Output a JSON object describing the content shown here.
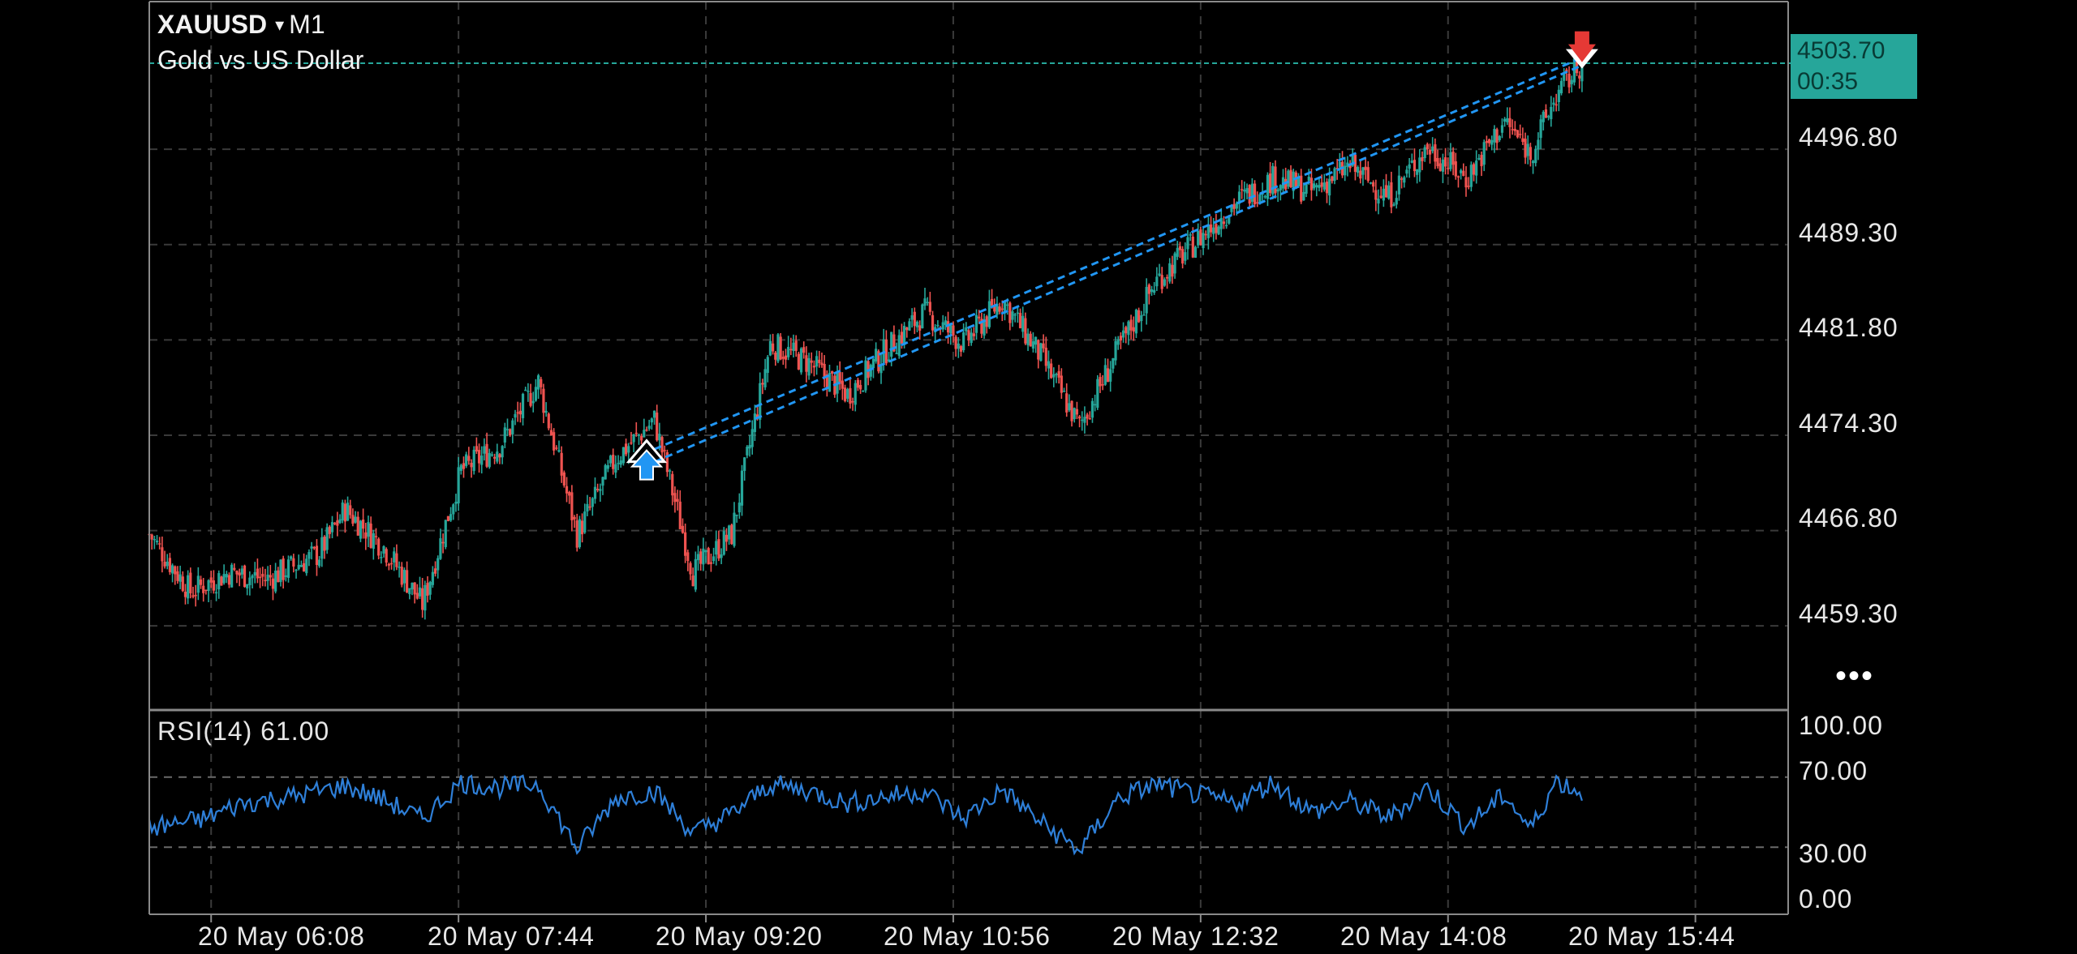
{
  "symbol": "XAUUSD",
  "timeframe": "M1",
  "description": "Gold vs US Dollar",
  "dropdown_glyph": "▾",
  "menu_glyph": "•••",
  "current_price": "4503.70",
  "candle_timer": "00:35",
  "price_axis": [
    "4496.80",
    "4489.30",
    "4481.80",
    "4474.30",
    "4466.80",
    "4459.30"
  ],
  "rsi": {
    "label": "RSI(14) 61.00",
    "levels": [
      "100.00",
      "70.00",
      "30.00",
      "0.00"
    ]
  },
  "time_axis": [
    "20 May 06:08",
    "20 May 07:44",
    "20 May 09:20",
    "20 May 10:56",
    "20 May 12:32",
    "20 May 14:08",
    "20 May 15:44"
  ],
  "colors": {
    "background": "#000000",
    "grid": "#3a3a3a",
    "bull": "#26a69a",
    "bear": "#ef5350",
    "trendline": "#2196f3",
    "rsi_line": "#2e7fd8",
    "price_tag": "#26a69a",
    "buy_arrow": "#2196f3",
    "sell_arrow": "#e53935"
  },
  "chart_data": {
    "type": "candlestick",
    "ylim": [
      4454.0,
      4505.0
    ],
    "xlim": [
      "20 May 05:44",
      "20 May 16:20"
    ],
    "price_path": [
      [
        "20 May 05:44",
        4466.5
      ],
      [
        "20 May 06:00",
        4462.0
      ],
      [
        "20 May 06:15",
        4463.5
      ],
      [
        "20 May 06:30",
        4463.0
      ],
      [
        "20 May 06:50",
        4465.0
      ],
      [
        "20 May 07:00",
        4468.5
      ],
      [
        "20 May 07:15",
        4465.5
      ],
      [
        "20 May 07:30",
        4461.0
      ],
      [
        "20 May 07:45",
        4471.5
      ],
      [
        "20 May 08:00",
        4473.5
      ],
      [
        "20 May 08:15",
        4478.5
      ],
      [
        "20 May 08:30",
        4466.5
      ],
      [
        "20 May 08:45",
        4472.5
      ],
      [
        "20 May 09:00",
        4475.5
      ],
      [
        "20 May 09:15",
        4463.5
      ],
      [
        "20 May 09:30",
        4466.5
      ],
      [
        "20 May 09:45",
        4481.5
      ],
      [
        "20 May 10:00",
        4480.0
      ],
      [
        "20 May 10:15",
        4477.5
      ],
      [
        "20 May 10:30",
        4481.0
      ],
      [
        "20 May 10:45",
        4484.0
      ],
      [
        "20 May 11:00",
        4481.5
      ],
      [
        "20 May 11:15",
        4485.0
      ],
      [
        "20 May 11:30",
        4480.5
      ],
      [
        "20 May 11:45",
        4475.0
      ],
      [
        "20 May 12:00",
        4481.0
      ],
      [
        "20 May 12:15",
        4486.5
      ],
      [
        "20 May 12:30",
        4489.5
      ],
      [
        "20 May 12:45",
        4492.5
      ],
      [
        "20 May 13:00",
        4494.5
      ],
      [
        "20 May 13:15",
        4493.5
      ],
      [
        "20 May 13:30",
        4495.5
      ],
      [
        "20 May 13:45",
        4493.0
      ],
      [
        "20 May 14:00",
        4497.0
      ],
      [
        "20 May 14:15",
        4494.5
      ],
      [
        "20 May 14:30",
        4499.0
      ],
      [
        "20 May 14:40",
        4496.5
      ],
      [
        "20 May 14:50",
        4501.0
      ],
      [
        "20 May 15:00",
        4503.7
      ]
    ],
    "trendlines": [
      {
        "from": [
          "20 May 09:00",
          4473.2
        ],
        "to": [
          "20 May 15:00",
          4504.0
        ]
      },
      {
        "from": [
          "20 May 09:00",
          4472.2
        ],
        "to": [
          "20 May 15:00",
          4503.4
        ]
      }
    ],
    "markers": [
      {
        "type": "buy",
        "time": "20 May 08:57",
        "price": 4472.6
      },
      {
        "type": "sell",
        "time": "20 May 15:00",
        "price": 4504.3
      }
    ],
    "rsi_path": [
      [
        "20 May 05:44",
        41
      ],
      [
        "20 May 06:05",
        46
      ],
      [
        "20 May 06:20",
        55
      ],
      [
        "20 May 06:40",
        59
      ],
      [
        "20 May 07:00",
        65
      ],
      [
        "20 May 07:15",
        57
      ],
      [
        "20 May 07:30",
        46
      ],
      [
        "20 May 07:45",
        67
      ],
      [
        "20 May 08:00",
        64
      ],
      [
        "20 May 08:15",
        66
      ],
      [
        "20 May 08:30",
        29
      ],
      [
        "20 May 08:45",
        58
      ],
      [
        "20 May 09:00",
        62
      ],
      [
        "20 May 09:15",
        38
      ],
      [
        "20 May 09:30",
        49
      ],
      [
        "20 May 09:45",
        66
      ],
      [
        "20 May 10:00",
        62
      ],
      [
        "20 May 10:15",
        55
      ],
      [
        "20 May 10:30",
        59
      ],
      [
        "20 May 10:45",
        62
      ],
      [
        "20 May 11:00",
        46
      ],
      [
        "20 May 11:15",
        63
      ],
      [
        "20 May 11:30",
        44
      ],
      [
        "20 May 11:45",
        28
      ],
      [
        "20 May 12:00",
        58
      ],
      [
        "20 May 12:15",
        66
      ],
      [
        "20 May 12:30",
        60
      ],
      [
        "20 May 12:45",
        55
      ],
      [
        "20 May 13:00",
        67
      ],
      [
        "20 May 13:15",
        50
      ],
      [
        "20 May 13:30",
        56
      ],
      [
        "20 May 13:45",
        47
      ],
      [
        "20 May 14:00",
        64
      ],
      [
        "20 May 14:15",
        42
      ],
      [
        "20 May 14:30",
        60
      ],
      [
        "20 May 14:40",
        40
      ],
      [
        "20 May 14:50",
        68
      ],
      [
        "20 May 15:00",
        61
      ]
    ]
  }
}
